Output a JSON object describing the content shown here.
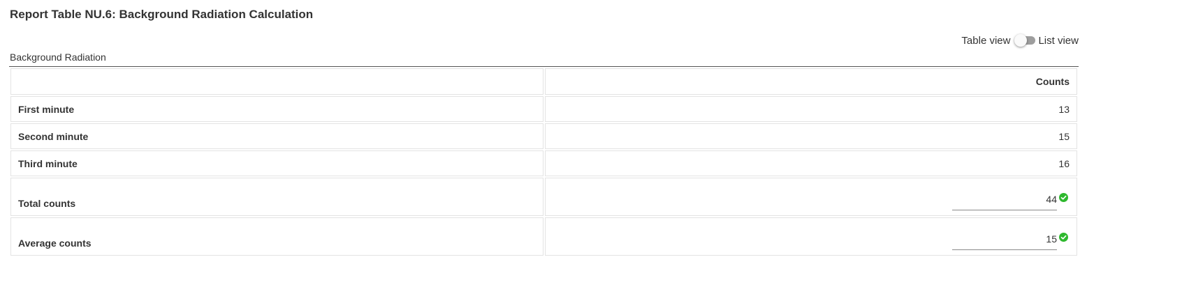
{
  "page": {
    "title": "Report Table NU.6: Background Radiation Calculation"
  },
  "view_toggle": {
    "left_label": "Table view",
    "right_label": "List view",
    "selected": "Table view"
  },
  "section": {
    "label": "Background Radiation"
  },
  "table": {
    "header": {
      "label_col": "",
      "value_col": "Counts"
    },
    "rows": [
      {
        "label": "First minute",
        "value": "13"
      },
      {
        "label": "Second minute",
        "value": "15"
      },
      {
        "label": "Third minute",
        "value": "16"
      }
    ],
    "input_rows": [
      {
        "label": "Total counts",
        "value": "44",
        "status_icon": "check-circle-icon"
      },
      {
        "label": "Average counts",
        "value": "15",
        "status_icon": "check-circle-icon"
      }
    ]
  },
  "colors": {
    "valid_green": "#2eb82e",
    "text": "#333333",
    "cell_border": "#e3e3e3",
    "toggle_track": "#9e9e9e"
  }
}
